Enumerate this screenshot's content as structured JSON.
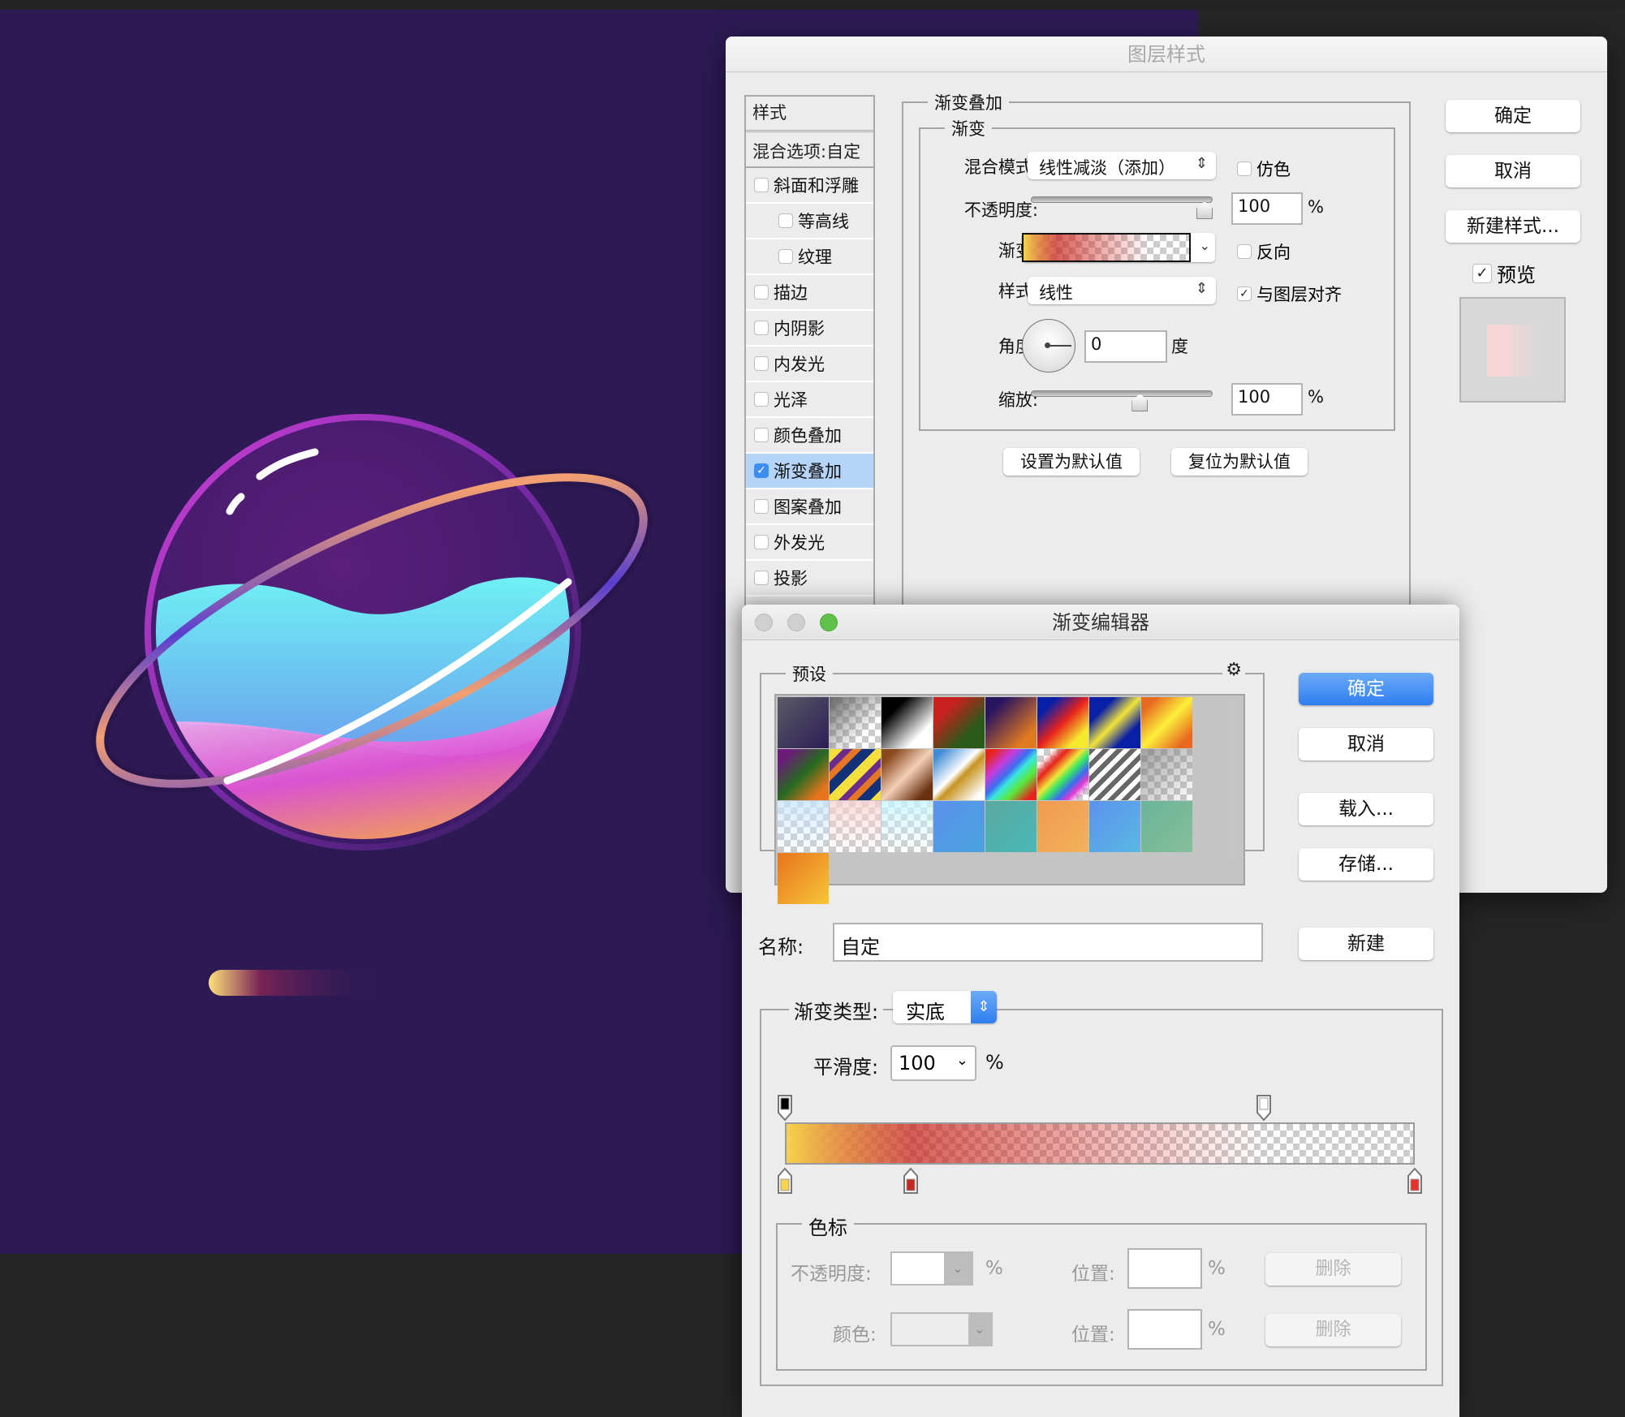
{
  "canvas": {
    "background_color": "#2d1a55",
    "artwork": "planet-with-ring",
    "colors": {
      "planet_rim": "#b03bd0",
      "water_top": "#6ff0f4",
      "water_bottom": "#6aa4ee",
      "lower_pink": "#e255d6",
      "ring": "#5a3fd0",
      "ring_highlight": "#ffffff",
      "streak_start": "#ffd27a",
      "streak_end": "#5a1f5a"
    }
  },
  "layer_style": {
    "title": "图层样式",
    "sidebar": {
      "header": "样式",
      "blend_options": "混合选项:自定",
      "items": [
        {
          "label": "斜面和浮雕",
          "checked": false,
          "indent": false
        },
        {
          "label": "等高线",
          "checked": false,
          "indent": true
        },
        {
          "label": "纹理",
          "checked": false,
          "indent": true
        },
        {
          "label": "描边",
          "checked": false,
          "indent": false
        },
        {
          "label": "内阴影",
          "checked": false,
          "indent": false
        },
        {
          "label": "内发光",
          "checked": false,
          "indent": false
        },
        {
          "label": "光泽",
          "checked": false,
          "indent": false
        },
        {
          "label": "颜色叠加",
          "checked": false,
          "indent": false
        },
        {
          "label": "渐变叠加",
          "checked": true,
          "indent": false,
          "active": true
        },
        {
          "label": "图案叠加",
          "checked": false,
          "indent": false
        },
        {
          "label": "外发光",
          "checked": false,
          "indent": false
        },
        {
          "label": "投影",
          "checked": false,
          "indent": false
        }
      ]
    },
    "panel": {
      "group_title": "渐变叠加",
      "subgroup_title": "渐变",
      "blend_mode_label": "混合模式:",
      "blend_mode_value": "线性减淡（添加）",
      "dither_label": "仿色",
      "dither_checked": false,
      "opacity_label": "不透明度:",
      "opacity_value": "100",
      "opacity_unit": "%",
      "opacity_slider_percent": 100,
      "gradient_label": "渐变:",
      "reverse_label": "反向",
      "reverse_checked": false,
      "style_label": "样式:",
      "style_value": "线性",
      "align_label": "与图层对齐",
      "align_checked": true,
      "angle_label": "角度:",
      "angle_value": "0",
      "angle_unit": "度",
      "scale_label": "缩放:",
      "scale_value": "100",
      "scale_unit": "%",
      "scale_slider_fraction": 0.6,
      "set_default": "设置为默认值",
      "reset_default": "复位为默认值"
    },
    "buttons": {
      "ok": "确定",
      "cancel": "取消",
      "new_style": "新建样式...",
      "preview_label": "预览",
      "preview_checked": true
    }
  },
  "gradient_editor": {
    "title": "渐变编辑器",
    "presets_label": "预设",
    "gear_icon": "gear-icon",
    "presets": [
      {
        "name": "purple-dark",
        "css": "linear-gradient(135deg,#5a5a66,#2c1e55)"
      },
      {
        "name": "gray-transparent",
        "css": "linear-gradient(135deg,#666 0%,rgba(150,150,150,0) 70%)",
        "checker": true
      },
      {
        "name": "black-white",
        "css": "linear-gradient(135deg,#000 25%,#fff 75%)"
      },
      {
        "name": "red-green",
        "css": "linear-gradient(135deg,#c8201e 25%,#2a5a1a 70%)"
      },
      {
        "name": "violet-orange",
        "css": "linear-gradient(135deg,#2a1560 20%,#e07a20 80%)"
      },
      {
        "name": "blue-red-yellow",
        "css": "linear-gradient(135deg,#0a1fa8 20%,#e8221c 50%,#f5e92e 80%)"
      },
      {
        "name": "blue-yellow-blue",
        "css": "linear-gradient(135deg,#0a1fa8 25%,#f1e33a 50%,#0a1fa8 75%)"
      },
      {
        "name": "orange-yellow-orange",
        "css": "linear-gradient(135deg,#e86a20 15%,#fbef3a 50%,#e86a20 85%)"
      },
      {
        "name": "violet-green-orange",
        "css": "linear-gradient(135deg,#6a1c78 15%,#276a20 50%,#e8751c 85%)"
      },
      {
        "name": "stripes-yellow-violet",
        "css": "repeating-linear-gradient(135deg,#f4df3c 0 12px,#6b2a8c 12px 20px,#e77622 20px 28px,#13317a 28px 40px)"
      },
      {
        "name": "copper",
        "css": "linear-gradient(135deg,#8a4a1e 15%,#f3d0b8 50%,#6a3010 85%)"
      },
      {
        "name": "chrome",
        "css": "linear-gradient(135deg,#3f8cd5 10%,#fff 45%,#c69320 55%,#fff 90%)"
      },
      {
        "name": "spectrum",
        "css": "linear-gradient(135deg,#e8221c 10%,#c83ce0 30%,#3a6cf0 45%,#3ae8e0 55%,#5ae83a 70%,#e8221c 90%)"
      },
      {
        "name": "transparent-rainbow",
        "css": "linear-gradient(135deg,rgba(255,255,255,0) 15%,#e8221c 30%,#f0e83a 45%,#3ae860 55%,#3a6cf0 68%,#e03ad0 78%,rgba(255,255,255,0) 90%)",
        "checker": true
      },
      {
        "name": "transparent-stripes",
        "css": "repeating-linear-gradient(135deg,#666 0 6px,#fff 6px 12px)"
      },
      {
        "name": "neutral-density",
        "css": "linear-gradient(135deg,rgba(120,120,120,.7),rgba(255,255,255,0))",
        "checker": true
      },
      {
        "name": "light-blue-transparent",
        "css": "linear-gradient(180deg,rgba(200,230,255,.8),rgba(255,255,255,0))",
        "checker": true
      },
      {
        "name": "pink-transparent",
        "css": "linear-gradient(180deg,rgba(250,210,210,.8),rgba(255,255,255,0))",
        "checker": true
      },
      {
        "name": "cyan-transparent",
        "css": "linear-gradient(180deg,rgba(200,245,255,.8),rgba(255,255,255,0))",
        "checker": true
      },
      {
        "name": "blue",
        "css": "linear-gradient(135deg,#5b92ec,#4aa3de)"
      },
      {
        "name": "teal",
        "css": "linear-gradient(135deg,#5aa8a0,#4ab8b8)"
      },
      {
        "name": "orange",
        "css": "linear-gradient(135deg,#f19a50,#f2b25a)"
      },
      {
        "name": "sky-blue",
        "css": "linear-gradient(135deg,#5b92ec,#5ab8e4)"
      },
      {
        "name": "green",
        "css": "linear-gradient(135deg,#6ab49a,#86be9a)"
      },
      {
        "name": "orange-yellow",
        "css": "linear-gradient(135deg,#e8751c,#f7c53a)"
      }
    ],
    "buttons": {
      "ok": "确定",
      "cancel": "取消",
      "load": "载入...",
      "save": "存储...",
      "new": "新建"
    },
    "name_label": "名称:",
    "name_value": "自定",
    "type_label": "渐变类型:",
    "type_value": "实底",
    "smoothness_label": "平滑度:",
    "smoothness_value": "100",
    "smoothness_unit": "%",
    "opacity_stops": [
      {
        "position_percent": 0,
        "opacity_percent": 100,
        "swatch": "#000000"
      },
      {
        "position_percent": 76,
        "opacity_percent": 0,
        "swatch": "#ffffff"
      }
    ],
    "color_stops": [
      {
        "position_percent": 0,
        "color": "#f7d24a"
      },
      {
        "position_percent": 20,
        "color": "#c8261e"
      },
      {
        "position_percent": 100,
        "color": "#e8302a"
      }
    ],
    "stops_group_label": "色标",
    "stop_opacity_label": "不透明度:",
    "stop_opacity_value": "",
    "stop_color_label": "颜色:",
    "position_label": "位置:",
    "position_unit": "%",
    "percent": "%",
    "delete": "删除"
  }
}
